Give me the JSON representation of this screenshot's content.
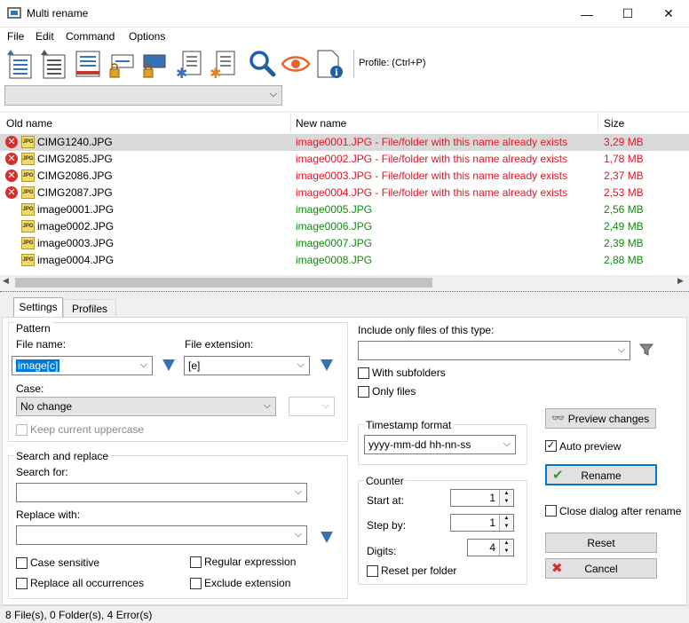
{
  "window": {
    "title": "Multi rename",
    "minimize": "—",
    "maximize": "☐",
    "close": "✕"
  },
  "menu": [
    "File",
    "Edit",
    "Command",
    "Options"
  ],
  "toolbar": {
    "profile_label": "Profile: (Ctrl+P)",
    "profile_value": ""
  },
  "columns": {
    "old": "Old name",
    "new": "New name",
    "size": "Size"
  },
  "rows": [
    {
      "old": "CIMG1240.JPG",
      "new": "image0001.JPG - File/folder with this name already exists",
      "size": "3,29 MB",
      "error": true
    },
    {
      "old": "CIMG2085.JPG",
      "new": "image0002.JPG - File/folder with this name already exists",
      "size": "1,78 MB",
      "error": true
    },
    {
      "old": "CIMG2086.JPG",
      "new": "image0003.JPG - File/folder with this name already exists",
      "size": "2,37 MB",
      "error": true
    },
    {
      "old": "CIMG2087.JPG",
      "new": "image0004.JPG - File/folder with this name already exists",
      "size": "2,53 MB",
      "error": true
    },
    {
      "old": "image0001.JPG",
      "new": "image0005.JPG",
      "size": "2,56 MB",
      "error": false
    },
    {
      "old": "image0002.JPG",
      "new": "image0006.JPG",
      "size": "2,49 MB",
      "error": false
    },
    {
      "old": "image0003.JPG",
      "new": "image0007.JPG",
      "size": "2,39 MB",
      "error": false
    },
    {
      "old": "image0004.JPG",
      "new": "image0008.JPG",
      "size": "2,88 MB",
      "error": false
    }
  ],
  "tabs": [
    "Settings",
    "Profiles"
  ],
  "pattern": {
    "legend": "Pattern",
    "file_name_label": "File name:",
    "file_name_value": "image[c]",
    "file_ext_label": "File extension:",
    "file_ext_value": "[e]",
    "case_label": "Case:",
    "case_value": "No change",
    "keep_upper": "Keep current uppercase"
  },
  "search": {
    "legend": "Search and replace",
    "search_label": "Search for:",
    "search_value": "",
    "replace_label": "Replace with:",
    "replace_value": "",
    "case_sensitive": "Case sensitive",
    "regex": "Regular expression",
    "replace_all": "Replace all occurrences",
    "exclude_ext": "Exclude extension"
  },
  "filter": {
    "include_label": "Include only files of this type:",
    "include_value": "",
    "subfolders": "With subfolders",
    "only_files": "Only files"
  },
  "timestamp": {
    "legend": "Timestamp format",
    "value": "yyyy-mm-dd hh-nn-ss"
  },
  "counter": {
    "legend": "Counter",
    "start_label": "Start at:",
    "start_value": "1",
    "step_label": "Step by:",
    "step_value": "1",
    "digits_label": "Digits:",
    "digits_value": "4",
    "reset_folder": "Reset per folder"
  },
  "actions": {
    "preview": "Preview changes",
    "auto_preview": "Auto preview",
    "rename": "Rename",
    "close_after": "Close dialog after rename",
    "reset": "Reset",
    "cancel": "Cancel"
  },
  "checks": {
    "auto_preview": "✓"
  },
  "status": "8 File(s), 0 Folder(s), 4 Error(s)",
  "colors": {
    "error": "#e81123",
    "ok": "#108a10",
    "accent": "#0078d7",
    "arrow": "#3672b7"
  }
}
